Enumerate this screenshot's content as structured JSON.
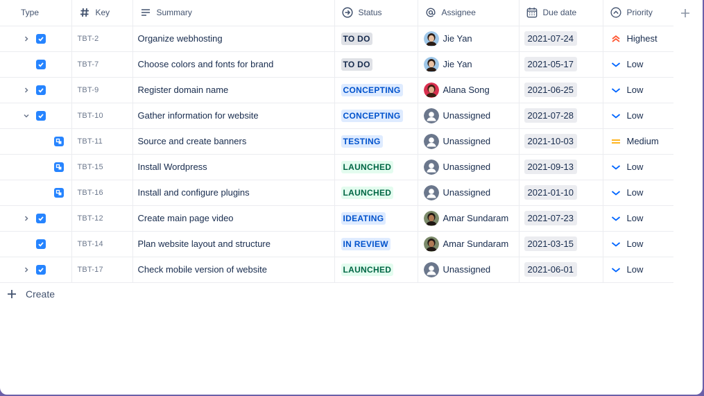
{
  "columns": {
    "type": "Type",
    "key": "Key",
    "summary": "Summary",
    "status": "Status",
    "assignee": "Assignee",
    "due_date": "Due date",
    "priority": "Priority"
  },
  "icons": {
    "key_column": "hash-icon",
    "summary_column": "lines-icon",
    "status_column": "arrow-circle-icon",
    "assignee_column": "at-sign-icon",
    "due_column": "calendar-icon",
    "priority_column": "chevron-up-circle-icon",
    "add_column": "plus-icon"
  },
  "colors": {
    "accent": "#2684ff",
    "highest": "#ff5630",
    "medium": "#ffab00",
    "low": "#0065ff"
  },
  "status_styles": {
    "TO DO": {
      "bg": "#dfe1e6",
      "fg": "#172b4d"
    },
    "CONCEPTING": {
      "bg": "#deebff",
      "fg": "#0052cc"
    },
    "TESTING": {
      "bg": "#deebff",
      "fg": "#0052cc"
    },
    "IDEATING": {
      "bg": "#deebff",
      "fg": "#0052cc"
    },
    "IN REVIEW": {
      "bg": "#deebff",
      "fg": "#0052cc"
    },
    "LAUNCHED": {
      "bg": "#e3fcef",
      "fg": "#006644"
    }
  },
  "rows": [
    {
      "kind": "task",
      "expand": "collapsed",
      "key": "TBT-2",
      "summary": "Organize webhosting",
      "status": "TO DO",
      "assignee": "Jie Yan",
      "avatar": "person-jie",
      "due": "2021-07-24",
      "priority": "Highest"
    },
    {
      "kind": "task",
      "expand": "none",
      "key": "TBT-7",
      "summary": "Choose colors and fonts for brand",
      "status": "TO DO",
      "assignee": "Jie Yan",
      "avatar": "person-jie",
      "due": "2021-05-17",
      "priority": "Low"
    },
    {
      "kind": "task",
      "expand": "collapsed",
      "key": "TBT-9",
      "summary": "Register domain name",
      "status": "CONCEPTING",
      "assignee": "Alana Song",
      "avatar": "person-alana",
      "due": "2021-06-25",
      "priority": "Low"
    },
    {
      "kind": "task",
      "expand": "expanded",
      "key": "TBT-10",
      "summary": "Gather information for website",
      "status": "CONCEPTING",
      "assignee": "Unassigned",
      "avatar": "unassigned",
      "due": "2021-07-28",
      "priority": "Low"
    },
    {
      "kind": "subtask",
      "expand": "none",
      "key": "TBT-11",
      "summary": "Source and create banners",
      "status": "TESTING",
      "assignee": "Unassigned",
      "avatar": "unassigned",
      "due": "2021-10-03",
      "priority": "Medium"
    },
    {
      "kind": "subtask",
      "expand": "none",
      "key": "TBT-15",
      "summary": "Install Wordpress",
      "status": "LAUNCHED",
      "assignee": "Unassigned",
      "avatar": "unassigned",
      "due": "2021-09-13",
      "priority": "Low"
    },
    {
      "kind": "subtask",
      "expand": "none",
      "key": "TBT-16",
      "summary": "Install and configure plugins",
      "status": "LAUNCHED",
      "assignee": "Unassigned",
      "avatar": "unassigned",
      "due": "2021-01-10",
      "priority": "Low"
    },
    {
      "kind": "task",
      "expand": "collapsed",
      "key": "TBT-12",
      "summary": "Create main page video",
      "status": "IDEATING",
      "assignee": "Amar Sundaram",
      "avatar": "person-amar",
      "due": "2021-07-23",
      "priority": "Low"
    },
    {
      "kind": "task",
      "expand": "none",
      "key": "TBT-14",
      "summary": "Plan website layout and structure",
      "status": "IN REVIEW",
      "assignee": "Amar Sundaram",
      "avatar": "person-amar",
      "due": "2021-03-15",
      "priority": "Low"
    },
    {
      "kind": "task",
      "expand": "collapsed",
      "key": "TBT-17",
      "summary": "Check mobile version of website",
      "status": "LAUNCHED",
      "assignee": "Unassigned",
      "avatar": "unassigned",
      "due": "2021-06-01",
      "priority": "Low"
    }
  ],
  "create": {
    "label": "Create"
  }
}
